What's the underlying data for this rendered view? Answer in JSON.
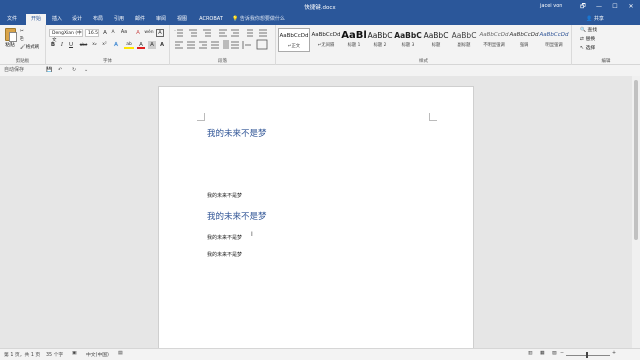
{
  "window": {
    "title": "快捷键.docx",
    "user": "jacei von",
    "controls": [
      "🗗",
      "—",
      "☐",
      "✕"
    ]
  },
  "tabs": [
    "文件",
    "开始",
    "插入",
    "设计",
    "布局",
    "引用",
    "邮件",
    "审阅",
    "视图",
    "ACROBAT"
  ],
  "tell_me": "告诉我你想要做什么",
  "share": "共享",
  "ribbon": {
    "clipboard": {
      "paste": "粘贴",
      "cut": "✂",
      "copy": "⎘",
      "format_painter": "格式刷",
      "label": "剪贴板"
    },
    "font": {
      "font_name": "DengXian (中文",
      "font_size": "16.5",
      "grow": "A",
      "shrink": "A",
      "change_case": "Aa",
      "clear": "A",
      "wen": "wén",
      "bold": "B",
      "italic": "I",
      "underline": "U",
      "strike": "abc",
      "subscript": "x₂",
      "superscript": "x²",
      "effects": "A",
      "highlight": "ab",
      "color": "A",
      "char_shade": "A",
      "char_border": "A",
      "label": "字体"
    },
    "paragraph": {
      "label": "段落"
    },
    "styles": {
      "items": [
        {
          "preview": "AaBbCcDd",
          "name": "↵正文"
        },
        {
          "preview": "AaBbCcDd",
          "name": "↵无间隔"
        },
        {
          "preview": "AaBl",
          "name": "标题 1"
        },
        {
          "preview": "AaBbC",
          "name": "标题 2"
        },
        {
          "preview": "AaBbC",
          "name": "标题 3"
        },
        {
          "preview": "AaBbC",
          "name": "标题"
        },
        {
          "preview": "AaBbC",
          "name": "副标题"
        },
        {
          "preview": "AaBbCcDd",
          "name": "不明显强调"
        },
        {
          "preview": "AaBbCcDd",
          "name": "强调"
        },
        {
          "preview": "AaBbCcDd",
          "name": "明显强调"
        }
      ],
      "label": "样式"
    },
    "editing": {
      "find": "查找",
      "replace": "替换",
      "select": "选择",
      "label": "编辑"
    }
  },
  "qat": {
    "start": "自动保存",
    "save": "💾",
    "undo": "↶",
    "redo": "↻",
    "more": "⌄"
  },
  "document": {
    "heading1": "我的未来不是梦",
    "para1": "我的未来不是梦",
    "heading2": "我的未来不是梦",
    "para2": "我的未来不是梦",
    "para3": "我的未来不是梦",
    "cursor": "I"
  },
  "status": {
    "page": "第 1 页，共 1 页",
    "words": "35 个字",
    "language": "中文(中国)",
    "zoom_minus": "−",
    "zoom_plus": "+"
  },
  "colors": {
    "accent": "#2b579a",
    "heading": "#2f5496"
  }
}
